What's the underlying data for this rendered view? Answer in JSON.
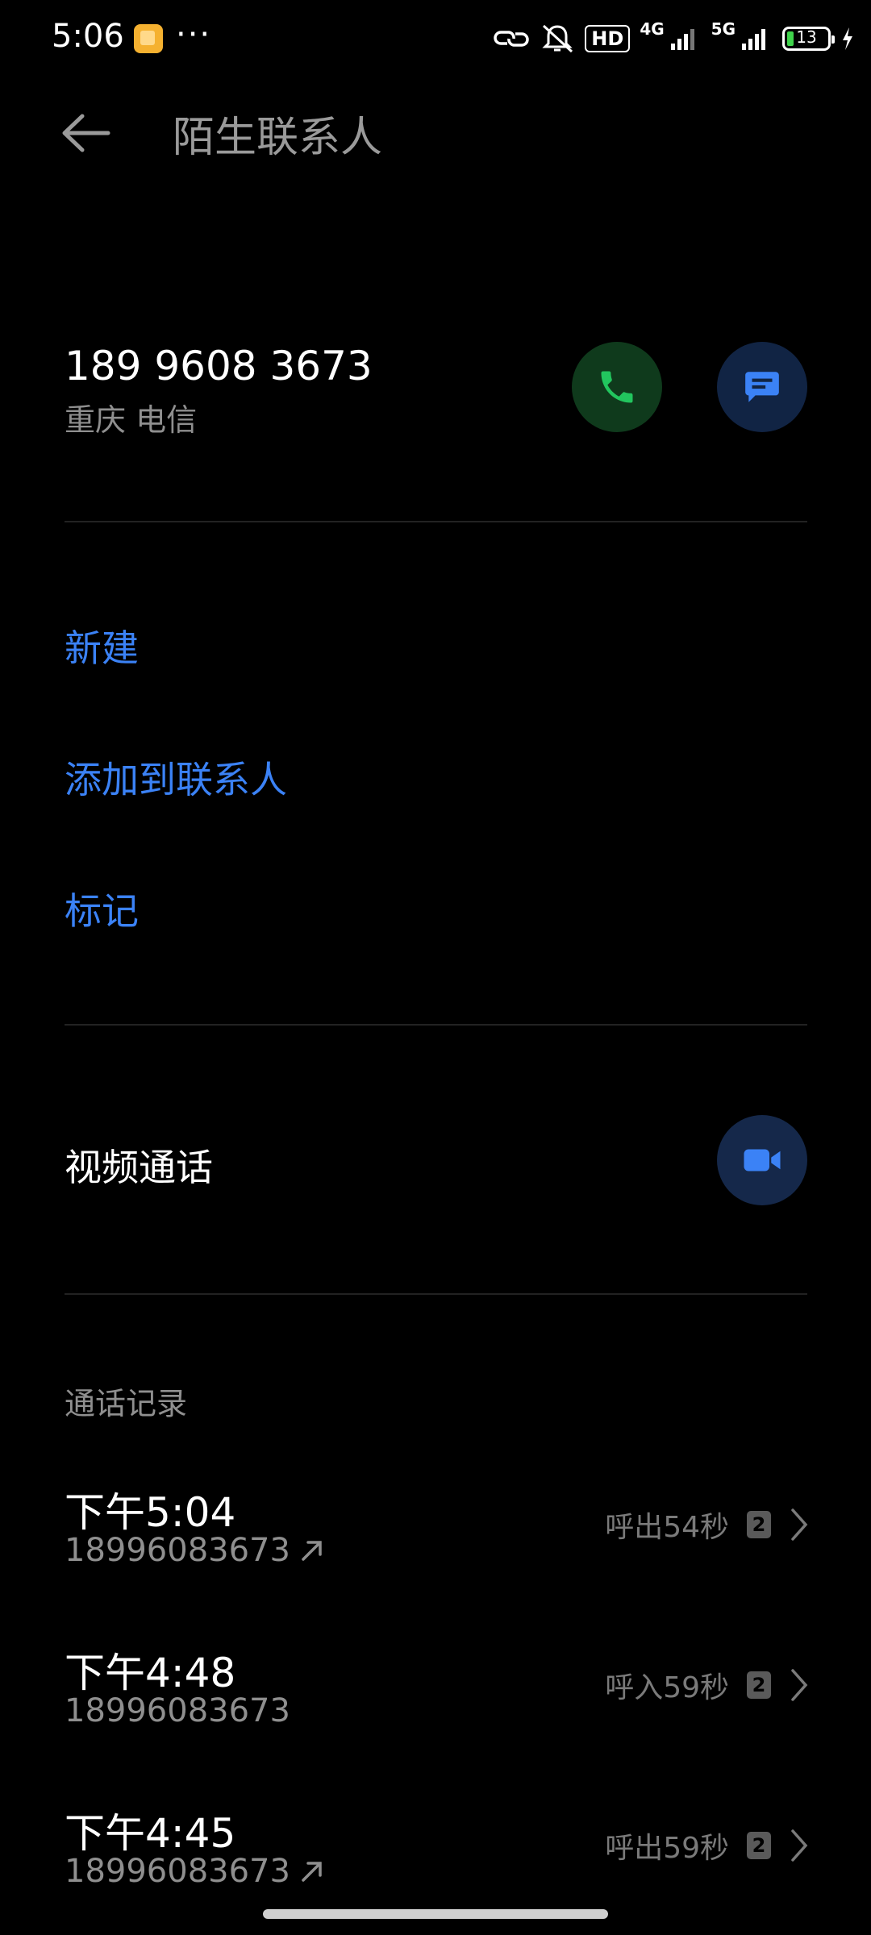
{
  "status_bar": {
    "time": "5:06",
    "dots": "···",
    "hd": "HD",
    "net1": "4G",
    "net2": "5G",
    "battery": "13"
  },
  "header": {
    "title": "陌生联系人"
  },
  "contact": {
    "number": "189 9608 3673",
    "location": "重庆 电信"
  },
  "actions": {
    "new": "新建",
    "add_to_contacts": "添加到联系人",
    "mark": "标记"
  },
  "video_call": {
    "label": "视频通话"
  },
  "call_log": {
    "title": "通话记录",
    "entries": [
      {
        "time": "下午5:04",
        "number": "18996083673",
        "status": "呼出54秒",
        "sim": "2",
        "direction": "outgoing"
      },
      {
        "time": "下午4:48",
        "number": "18996083673",
        "status": "呼入59秒",
        "sim": "2",
        "direction": "incoming"
      },
      {
        "time": "下午4:45",
        "number": "18996083673",
        "status": "呼出59秒",
        "sim": "2",
        "direction": "outgoing"
      }
    ]
  },
  "colors": {
    "accent_blue": "#3b82f6",
    "call_green": "#22c55e",
    "background": "#000000"
  }
}
